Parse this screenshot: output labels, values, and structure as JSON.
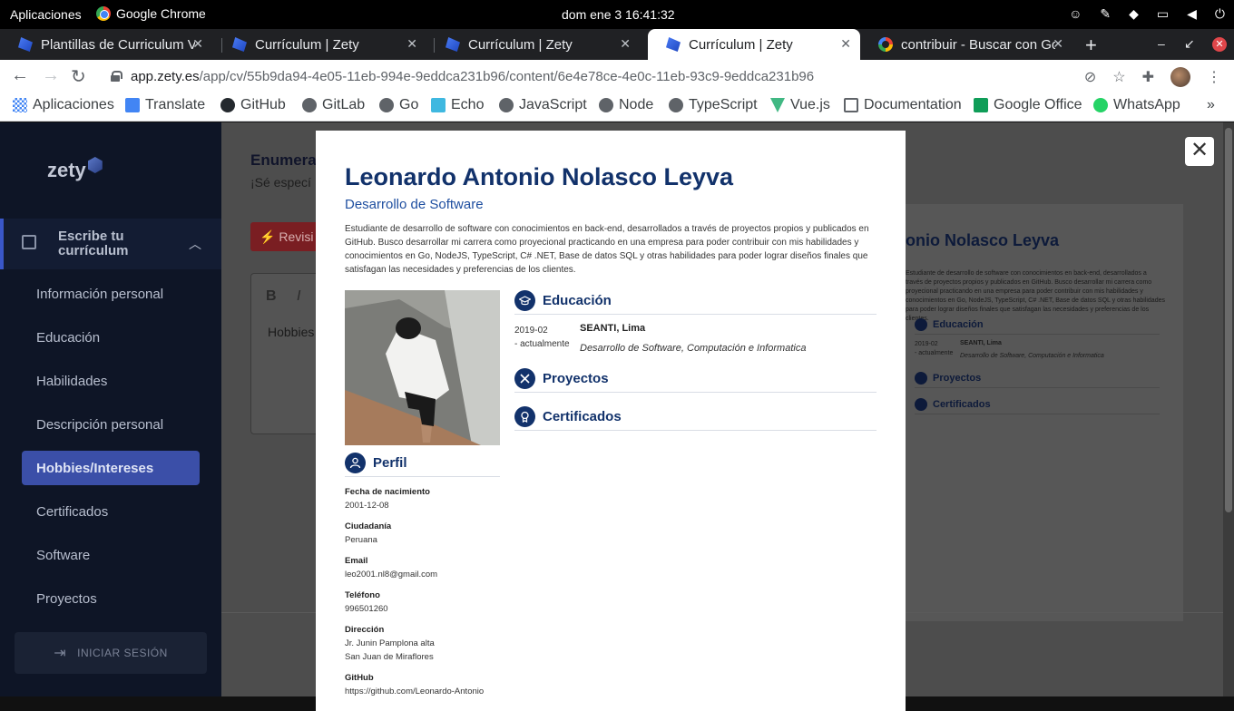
{
  "system_bar": {
    "apps_label": "Aplicaciones",
    "active_app": "Google Chrome",
    "clock": "dom ene 3  16:41:32"
  },
  "tabs": [
    {
      "title": "Plantillas de Curriculum V",
      "favicon": "zety-icon"
    },
    {
      "title": "Currículum | Zety",
      "favicon": "zety-icon"
    },
    {
      "title": "Currículum | Zety",
      "favicon": "zety-icon"
    },
    {
      "title": "Currículum | Zety",
      "favicon": "zety-icon",
      "active": true
    },
    {
      "title": "contribuir - Buscar con Go",
      "favicon": "google-icon"
    }
  ],
  "address_bar": {
    "host": "app.zety.es",
    "path": "/app/cv/55b9da94-4e05-11eb-994e-9eddca231b96/content/6e4e78ce-4e0c-11eb-93c9-9eddca231b96"
  },
  "bookmarks": [
    {
      "label": "Aplicaciones",
      "icon": "apps-grid-icon"
    },
    {
      "label": "Translate",
      "icon": "translate-icon"
    },
    {
      "label": "GitHub",
      "icon": "github-icon"
    },
    {
      "label": "GitLab",
      "icon": "globe-icon"
    },
    {
      "label": "Go",
      "icon": "globe-icon"
    },
    {
      "label": "Echo",
      "icon": "echo-icon"
    },
    {
      "label": "JavaScript",
      "icon": "globe-icon"
    },
    {
      "label": "Node",
      "icon": "globe-icon"
    },
    {
      "label": "TypeScript",
      "icon": "globe-icon"
    },
    {
      "label": "Vue.js",
      "icon": "vue-icon"
    },
    {
      "label": "Documentation",
      "icon": "doc-icon"
    },
    {
      "label": "Google Office",
      "icon": "sheets-icon"
    },
    {
      "label": "WhatsApp",
      "icon": "whatsapp-icon"
    }
  ],
  "sidebar": {
    "logo": "zety",
    "section_label": "Escribe tu currículum",
    "items": [
      {
        "label": "Información personal"
      },
      {
        "label": "Educación"
      },
      {
        "label": "Habilidades"
      },
      {
        "label": "Descripción personal"
      },
      {
        "label": "Hobbies/Intereses",
        "active": true
      },
      {
        "label": "Certificados"
      },
      {
        "label": "Software"
      },
      {
        "label": "Proyectos"
      }
    ],
    "login_label": "INICIAR SESIÓN"
  },
  "background": {
    "heading": "Enumera",
    "subheading": "¡Sé especí",
    "review_button": "Revisi",
    "editor_text": "Hobbies",
    "preview_name": "onio Nolasco Leyva"
  },
  "cv": {
    "name": "Leonardo Antonio Nolasco Leyva",
    "title": "Desarrollo de Software",
    "summary": "Estudiante de desarrollo de software con conocimientos en back-end, desarrollados a través de proyectos propios y publicados en GitHub. Busco desarrollar mi carrera como proyecional practicando en una empresa para poder contribuir  con mis habilidades y conocimientos en Go, NodeJS, TypeScript, C# .NET, Base de datos SQL y otras habilidades para poder lograr diseños finales que satisfagan las necesidades y preferencias de los clientes.",
    "sections": {
      "profile": "Perfil",
      "education": "Educación",
      "projects": "Proyectos",
      "certificates": "Certificados"
    },
    "profile_fields": [
      {
        "label": "Fecha de nacimiento",
        "value": "2001-12-08"
      },
      {
        "label": "Ciudadanía",
        "value": "Peruana"
      },
      {
        "label": "Email",
        "value": "leo2001.nl8@gmail.com"
      },
      {
        "label": "Teléfono",
        "value": "996501260"
      },
      {
        "label": "Dirección",
        "value": "Jr. Junin Pamplona alta",
        "value2": "San Juan de Miraflores"
      },
      {
        "label": "GitHub",
        "value": "https://github.com/Leonardo-Antonio"
      }
    ],
    "education": {
      "date_start": "2019-02",
      "date_end": "- actualmente",
      "school": "SEANTI, Lima",
      "degree": "Desarrollo de Software, Computación e Informatica"
    }
  },
  "colors": {
    "cv_accent": "#12326b",
    "sidebar_bg": "#0e1526",
    "sidebar_active": "#3b4fa8"
  }
}
